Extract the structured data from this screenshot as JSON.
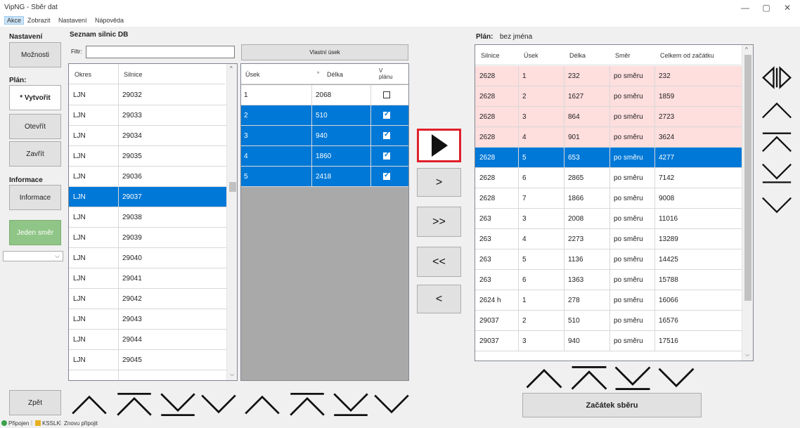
{
  "window": {
    "title": "VipNG - Sběr dat",
    "min": "—",
    "max": "▢",
    "close": "✕"
  },
  "menu": [
    "Akce",
    "Zobrazit",
    "Nastavení",
    "Nápověda"
  ],
  "sidebar": {
    "nastaveni_label": "Nastavení",
    "moznosti": "Možnosti",
    "plan_label": "Plán:",
    "vytvorit": "* Vytvořit",
    "otevrit": "Otevřít",
    "zavrit": "Zavřít",
    "informace_label": "Informace",
    "informace": "Informace",
    "jeden_smer": "Jeden směr",
    "zpet": "Zpět"
  },
  "roads": {
    "title": "Seznam silnic DB",
    "filter_label": "Filtr:",
    "filter_value": "",
    "col_okres": "Okres",
    "col_silnice": "Silnice",
    "rows": [
      [
        "LJN",
        "29032"
      ],
      [
        "LJN",
        "29033"
      ],
      [
        "LJN",
        "29034"
      ],
      [
        "LJN",
        "29035"
      ],
      [
        "LJN",
        "29036"
      ],
      [
        "LJN",
        "29037"
      ],
      [
        "LJN",
        "29038"
      ],
      [
        "LJN",
        "29039"
      ],
      [
        "LJN",
        "29040"
      ],
      [
        "LJN",
        "29041"
      ],
      [
        "LJN",
        "29042"
      ],
      [
        "LJN",
        "29043"
      ],
      [
        "LJN",
        "29044"
      ],
      [
        "LJN",
        "29045"
      ]
    ],
    "selected_index": 5
  },
  "segments": {
    "vlastni_usek": "Vlastní úsek",
    "col_usek": "Úsek",
    "col_delka": "Délka",
    "col_vplanu": "V\nplánu",
    "rows": [
      {
        "usek": "1",
        "delka": "2068",
        "in_plan": false
      },
      {
        "usek": "2",
        "delka": "510",
        "in_plan": true
      },
      {
        "usek": "3",
        "delka": "940",
        "in_plan": true
      },
      {
        "usek": "4",
        "delka": "1860",
        "in_plan": true
      },
      {
        "usek": "5",
        "delka": "2418",
        "in_plan": true
      }
    ]
  },
  "transfer": {
    "add_one": ">",
    "add_all": ">>",
    "remove_all": "<<",
    "remove_one": "<"
  },
  "plan": {
    "label": "Plán:",
    "name": "bez jména",
    "columns": [
      "Silnice",
      "Úsek",
      "Délka",
      "Směr",
      "Celkem od začátku"
    ],
    "rows": [
      [
        "2628",
        "1",
        "232",
        "po směru",
        "232"
      ],
      [
        "2628",
        "2",
        "1627",
        "po směru",
        "1859"
      ],
      [
        "2628",
        "3",
        "864",
        "po směru",
        "2723"
      ],
      [
        "2628",
        "4",
        "901",
        "po směru",
        "3624"
      ],
      [
        "2628",
        "5",
        "653",
        "po směru",
        "4277"
      ],
      [
        "2628",
        "6",
        "2865",
        "po směru",
        "7142"
      ],
      [
        "2628",
        "7",
        "1866",
        "po směru",
        "9008"
      ],
      [
        "263",
        "3",
        "2008",
        "po směru",
        "11016"
      ],
      [
        "263",
        "4",
        "2273",
        "po směru",
        "13289"
      ],
      [
        "263",
        "5",
        "1136",
        "po směru",
        "14425"
      ],
      [
        "263",
        "6",
        "1363",
        "po směru",
        "15788"
      ],
      [
        "2624  h",
        "1",
        "278",
        "po směru",
        "16066"
      ],
      [
        "29037",
        "2",
        "510",
        "po směru",
        "16576"
      ],
      [
        "29037",
        "3",
        "940",
        "po směru",
        "17516"
      ]
    ],
    "pink_rows": [
      0,
      1,
      2,
      3
    ],
    "selected_index": 4,
    "start": "Začátek sběru"
  },
  "status": {
    "connected": "Připojen",
    "server": "KSSLK",
    "reconnect": "Znovu připojit"
  },
  "colors": {
    "selection": "#0078d7",
    "pink": "#ffdede",
    "green": "#8fc586",
    "highlight": "#e0202a"
  }
}
